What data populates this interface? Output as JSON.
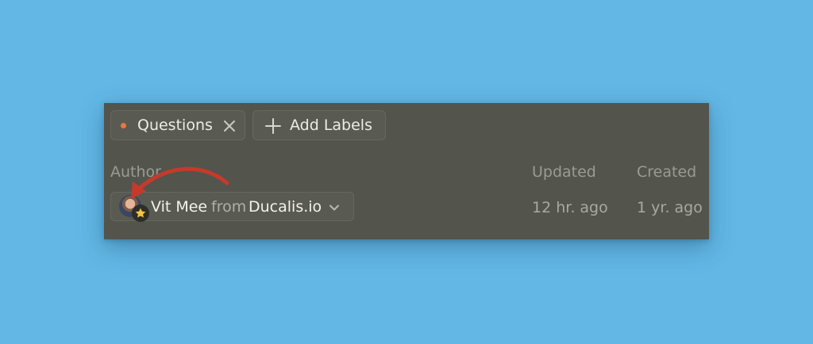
{
  "labels": {
    "questions": {
      "text": "Questions",
      "dot_color": "#e8783e",
      "remove_icon": "close-icon"
    },
    "add": {
      "text": "Add Labels",
      "icon": "plus-icon"
    }
  },
  "columns": {
    "author": "Author",
    "updated": "Updated",
    "created": "Created"
  },
  "row": {
    "author_name": "Vit Mee",
    "from_text": "from",
    "organization": "Ducalis.io",
    "badge_icon": "star-icon",
    "dropdown_icon": "chevron-down-icon",
    "updated": "12 hr. ago",
    "created": "1 yr. ago"
  },
  "colors": {
    "background": "#62b7e5",
    "panel": "#53544c",
    "annotation_arrow": "#c63a2b"
  }
}
